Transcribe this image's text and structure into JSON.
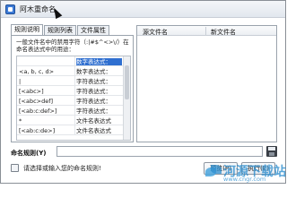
{
  "window": {
    "title": "阿木重命名"
  },
  "tabs": [
    {
      "label": "规则说明",
      "active": true
    },
    {
      "label": "规则列表",
      "active": false
    },
    {
      "label": "文件属性",
      "active": false
    }
  ],
  "rules_panel": {
    "description": "一般文件名中的禁用字符（:|#$^<>\\/）在命名表达式中的用途：",
    "rows": [
      {
        "pattern": "",
        "meaning": "数字表达式：",
        "selected": true
      },
      {
        "pattern": "<a, b, c, d>",
        "meaning": "数字表达式：",
        "selected": false
      },
      {
        "pattern": "|",
        "meaning": "字符表达式：",
        "selected": false
      },
      {
        "pattern": "[<abc>]",
        "meaning": "字符表达式：",
        "selected": false
      },
      {
        "pattern": "[<abc>def]",
        "meaning": "字符表达式：",
        "selected": false
      },
      {
        "pattern": "[<ab:c:def>]",
        "meaning": "字符表达式：",
        "selected": false
      },
      {
        "pattern": "*",
        "meaning": "文件名表达式",
        "selected": false
      },
      {
        "pattern": "[<ab:c:de>]",
        "meaning": "文件名表达式",
        "selected": false
      }
    ]
  },
  "preview": {
    "col_source": "源文件名",
    "col_new": "新文件名"
  },
  "rule_input": {
    "label": "命名规则(Y)",
    "value": ""
  },
  "status": {
    "text": "请选择或输入您的命名规则!"
  },
  "buttons": {
    "preview": "预览(P)",
    "execute": "执行(E)"
  },
  "watermark": {
    "text": "河源下载站",
    "url": "www.cngr.com"
  },
  "colors": {
    "selection": "#2f6fd0",
    "watermark": "#2f8fcf"
  }
}
